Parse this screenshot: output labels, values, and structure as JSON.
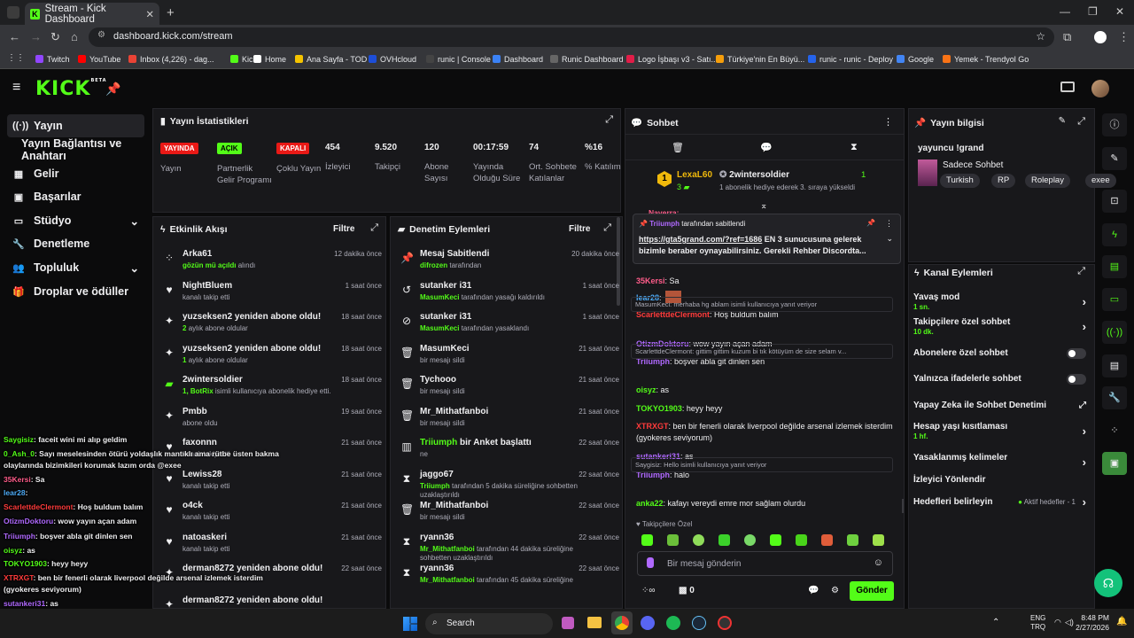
{
  "browser": {
    "tab_title": "Stream - Kick Dashboard",
    "url": "dashboard.kick.com/stream",
    "bookmarks": [
      {
        "label": "Twitch",
        "color": "#9146ff"
      },
      {
        "label": "YouTube",
        "color": "#ff0000"
      },
      {
        "label": "Inbox (4,226) - dag...",
        "color": "#ea4335"
      },
      {
        "label": "Kick",
        "color": "#53fc18"
      },
      {
        "label": "Home",
        "color": "#ffffff"
      },
      {
        "label": "Ana Sayfa - TOD",
        "color": "#f5c400"
      },
      {
        "label": "OVHcloud",
        "color": "#1d4ed8"
      },
      {
        "label": "runic | Console",
        "color": "#444444"
      },
      {
        "label": "Dashboard",
        "color": "#3b82f6"
      },
      {
        "label": "Runic Dashboard",
        "color": "#666666"
      },
      {
        "label": "Logo İşbaşı v3 - Satı...",
        "color": "#e11d48"
      },
      {
        "label": "Türkiye'nin En Büyü...",
        "color": "#f59e0b"
      },
      {
        "label": "runic - runic - Deploy",
        "color": "#2563eb"
      },
      {
        "label": "Google",
        "color": "#4285f4"
      },
      {
        "label": "Yemek - Trendyol Go",
        "color": "#f97316"
      }
    ]
  },
  "kick": {
    "logo": "KICK",
    "beta": "BETA"
  },
  "sidebar": [
    {
      "label": "Yayın",
      "icon": "broadcast-icon"
    },
    {
      "label": "Yayın Bağlantısı ve Anahtarı",
      "icon": ""
    },
    {
      "label": "Gelir",
      "icon": "revenue-icon"
    },
    {
      "label": "Başarılar",
      "icon": "achievements-icon"
    },
    {
      "label": "Stüdyo",
      "icon": "studio-icon"
    },
    {
      "label": "Denetleme",
      "icon": "moderation-icon"
    },
    {
      "label": "Topluluk",
      "icon": "community-icon"
    },
    {
      "label": "Droplar ve ödüller",
      "icon": "drops-icon"
    }
  ],
  "stats": {
    "title": "Yayın İstatistikleri",
    "items": [
      {
        "badge": "YAYINDA",
        "badge_color": "#e91916",
        "label": "Yayın"
      },
      {
        "badge": "AÇIK",
        "badge_color": "#53fc18",
        "label": "Partnerlik Gelir Programı"
      },
      {
        "badge": "KAPALI",
        "badge_color": "#e91916",
        "label": "Çoklu Yayın"
      },
      {
        "value": "454",
        "label": "İzleyici"
      },
      {
        "value": "9.520",
        "label": "Takipçi"
      },
      {
        "value": "120",
        "label": "Abone Sayısı"
      },
      {
        "value": "00:17:59",
        "label": "Yayında Olduğu Süre"
      },
      {
        "value": "74",
        "label": "Ort. Sohbete Katılanlar"
      },
      {
        "value": "%16",
        "label": "% Katılım"
      }
    ]
  },
  "activity": {
    "title": "Etkinlik Akışı",
    "filter": "Filtre",
    "items": [
      {
        "name": "Arka61",
        "sub": "gözün mü açıldı",
        "sub2": "alındı",
        "time": "12 dakika önce",
        "icon": "dots"
      },
      {
        "name": "NightBluem",
        "sub": "kanalı takip etti",
        "time": "1 saat önce",
        "icon": "heart"
      },
      {
        "name": "yuzseksen2 yeniden abone oldu!",
        "sub": "2",
        "sub2": "aylık abone oldular",
        "time": "18 saat önce",
        "icon": "star"
      },
      {
        "name": "yuzseksen2 yeniden abone oldu!",
        "sub": "1",
        "sub2": "aylık abone oldular",
        "time": "18 saat önce",
        "icon": "star"
      },
      {
        "name": "2wintersoldier",
        "sub": "1, BotRix",
        "sub2": "isimli kullanıcıya abonelik hediye etti.",
        "time": "18 saat önce",
        "icon": "gift"
      },
      {
        "name": "Pmbb",
        "sub": "abone oldu",
        "time": "19 saat önce",
        "icon": "star"
      },
      {
        "name": "faxonnn",
        "sub": "kanalı takip etti",
        "time": "21 saat önce",
        "icon": "heart"
      },
      {
        "name": "Lewiss28",
        "sub": "kanalı takip etti",
        "time": "21 saat önce",
        "icon": "heart"
      },
      {
        "name": "o4ck",
        "sub": "kanalı takip etti",
        "time": "21 saat önce",
        "icon": "heart"
      },
      {
        "name": "natoaskeri",
        "sub": "kanalı takip etti",
        "time": "21 saat önce",
        "icon": "heart"
      },
      {
        "name": "derman8272 yeniden abone oldu!",
        "sub": "",
        "time": "22 saat önce",
        "icon": "star"
      },
      {
        "name": "derman8272 yeniden abone oldu!",
        "sub": "",
        "time": "",
        "icon": "star"
      }
    ]
  },
  "moderation": {
    "title": "Denetim Eylemleri",
    "filter": "Filtre",
    "items": [
      {
        "name": "Mesaj Sabitlendi",
        "sub": "difrozen",
        "sub2": "tarafından",
        "time": "20 dakika önce",
        "icon": "pin"
      },
      {
        "name": "sutanker i31",
        "sub": "MasumKeci",
        "sub2": "tarafından yasağı kaldırıldı",
        "time": "1 saat önce",
        "icon": "undo"
      },
      {
        "name": "sutanker i31",
        "sub": "MasumKeci",
        "sub2": "tarafından yasaklandı",
        "time": "1 saat önce",
        "icon": "ban"
      },
      {
        "name": "MasumKeci",
        "sub": "bir mesajı sildi",
        "time": "21 saat önce",
        "icon": "trash"
      },
      {
        "name": "Tychooo",
        "sub": "bir mesajı sildi",
        "time": "21 saat önce",
        "icon": "trash"
      },
      {
        "name": "Mr_Mithatfanboi",
        "sub": "bir mesajı sildi",
        "time": "21 saat önce",
        "icon": "trash"
      },
      {
        "name": "Triiumph",
        "name2": "bir Anket başlattı",
        "sub": "ne",
        "time": "22 saat önce",
        "icon": "poll"
      },
      {
        "name": "jaggo67",
        "sub": "Triiumph",
        "sub2": "tarafından 5 dakika süreliğine sohbetten uzaklaştırıldı",
        "time": "22 saat önce",
        "icon": "hourglass"
      },
      {
        "name": "Mr_Mithatfanboi",
        "sub": "bir mesajı sildi",
        "time": "22 saat önce",
        "icon": "trash"
      },
      {
        "name": "ryann36",
        "sub": "Mr_Mithatfanboi",
        "sub2": "tarafından 44 dakika süreliğine sohbetten uzaklaştırıldı",
        "time": "22 saat önce",
        "icon": "hourglass"
      },
      {
        "name": "ryann36",
        "sub": "Mr_Mithatfanboi",
        "sub2": "tarafından 45 dakika süreliğine",
        "time": "22 saat önce",
        "icon": "hourglass"
      }
    ]
  },
  "chat": {
    "title": "Sohbet",
    "top_user": "LexaL60",
    "top_user_count": "3",
    "gifter": "2wintersoldier",
    "gifter_count": "1",
    "gifter_text": "1 abonelik hediye ederek 3. sıraya yükseldi",
    "partial_name": "Naverra:",
    "pinned_by": "Triiumph",
    "pinned_by_suffix": "tarafından sabitlendi",
    "pinned_text": "https://gta5grand.com/?ref=1686",
    "pinned_rest": " EN 3 sunucusuna gelerek bizimle beraber oynayabilirsiniz. Gerekli Rehber Discordta...",
    "messages": [
      {
        "user": "35Kersi",
        "color": "#ff5c8a",
        "text": ": Sa"
      },
      {
        "user": "lear28",
        "color": "#4dabf7",
        "text": ":"
      },
      {
        "reply": "MasumKeci: merhaba hg ablam",
        "reply2": "isimli kullanıcıya yanıt veriyor",
        "user": "ScarlettdeClermont",
        "color": "#ff3b3b",
        "text": ": Hoş buldum balım"
      },
      {
        "user": "OtizmDoktoru",
        "color": "#b069ff",
        "text": ": wow yayın açan adam"
      },
      {
        "reply": "ScarlettdeClermont: gittim gittim kuzum bi tık kötüyüm de size selam v...",
        "user": "Triiumph",
        "color": "#b069ff",
        "text": ": boşver abla git dinlen sen"
      },
      {
        "user": "oisyz",
        "color": "#53fc18",
        "text": ": as"
      },
      {
        "user": "TOKYO1903",
        "color": "#53fc18",
        "text": ": heyy heyy"
      },
      {
        "user": "XTRXGT",
        "color": "#ff3b3b",
        "text": ": ben bir fenerli olarak liverpool değilde arsenal izlemek isterdim (gyokeres seviyorum)"
      },
      {
        "user": "sutankeri31",
        "color": "#b069ff",
        "text": ": as"
      },
      {
        "reply": "Saygisiz: Hello isimli kullanıcıya yanıt veriyor",
        "user": "Triiumph",
        "color": "#b069ff",
        "text": ": halo"
      },
      {
        "user": "anka22",
        "color": "#53fc18",
        "text": ": kafayı vereydi emre mor sağlam olurdu"
      }
    ],
    "emote_label": "Takipçilere Özel",
    "input_placeholder": "Bir mesaj gönderin",
    "points": "0",
    "send": "Gönder"
  },
  "overlay": [
    {
      "user": "Saygisiz",
      "color": "#53fc18",
      "text": ": faceit wini mi alıp geldim"
    },
    {
      "user": "0_Ash_0",
      "color": "#53fc18",
      "text": ": Sayı meselesinden ötürü yoldaşlık mantıklı ama rütbe üsten bakma"
    },
    {
      "user": "",
      "color": "#ffffff",
      "text": "olaylarında bizimkileri korumak lazım orda @exee"
    },
    {
      "user": "35Kersi",
      "color": "#ff5c8a",
      "text": ": Sa"
    },
    {
      "user": "lear28",
      "color": "#4dabf7",
      "text": ":"
    },
    {
      "user": "ScarlettdeClermont",
      "color": "#ff3b3b",
      "text": ": Hoş buldum balım"
    },
    {
      "user": "OtizmDoktoru",
      "color": "#b069ff",
      "text": ": wow yayın açan adam"
    },
    {
      "user": "Triiumph",
      "color": "#b069ff",
      "text": ": boşver abla git dinlen sen"
    },
    {
      "user": "oisyz",
      "color": "#53fc18",
      "text": ": as"
    },
    {
      "user": "TOKYO1903",
      "color": "#53fc18",
      "text": ": heyy heyy"
    },
    {
      "user": "XTRXGT",
      "color": "#ff3b3b",
      "text": ": ben bir fenerli olarak liverpool değilde arsenal izlemek isterdim"
    },
    {
      "user": "",
      "color": "#ffffff",
      "text": "(gyokeres seviyorum)"
    },
    {
      "user": "sutankeri31",
      "color": "#b069ff",
      "text": ": as"
    },
    {
      "user": "Triiumph",
      "color": "#b069ff",
      "text": ": halo"
    },
    {
      "user": "anka22",
      "color": "#53fc18",
      "text": ": kafayı vereydi emre mor sağlam olurdu"
    }
  ],
  "info": {
    "title": "Yayın bilgisi",
    "streamer": "yayuncu !grand",
    "category": "Sadece Sohbet",
    "tags": [
      "Turkish",
      "RP",
      "Roleplay",
      "exee"
    ]
  },
  "actions": {
    "title": "Kanal Eylemleri",
    "items": [
      {
        "label": "Yavaş mod",
        "sub": "1 sn.",
        "type": "arrow"
      },
      {
        "label": "Takipçilere özel sohbet",
        "sub": "10 dk.",
        "type": "arrow"
      },
      {
        "label": "Abonelere özel sohbet",
        "sub": "",
        "type": "toggle"
      },
      {
        "label": "Yalnızca ifadelerle sohbet",
        "sub": "",
        "type": "toggle"
      },
      {
        "label": "Yapay Zeka ile Sohbet Denetimi",
        "sub": "",
        "type": "ext"
      },
      {
        "label": "Hesap yaşı kısıtlaması",
        "sub": "1 hf.",
        "type": "arrow"
      },
      {
        "label": "Yasaklanmış kelimeler",
        "sub": "",
        "type": "arrow"
      },
      {
        "label": "İzleyici Yönlendir",
        "sub": "",
        "type": "none"
      },
      {
        "label": "Hedefleri belirleyin",
        "sub": "",
        "type": "goal",
        "extra": "Aktif hedefler - 1"
      }
    ]
  },
  "taskbar": {
    "search": "Search",
    "lang1": "ENG",
    "lang2": "TRQ",
    "time": "8:48 PM",
    "date": "2/27/2026"
  }
}
